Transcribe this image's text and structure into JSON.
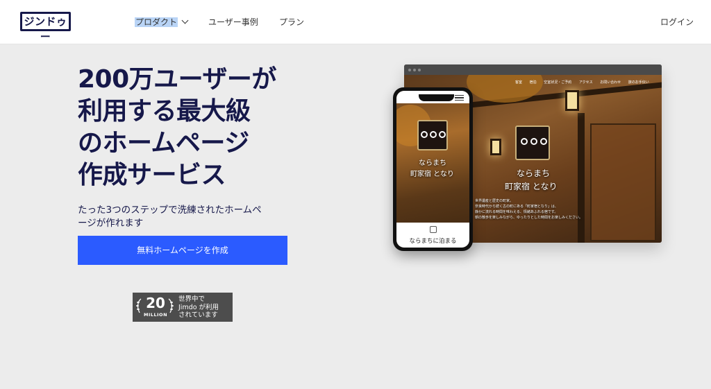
{
  "header": {
    "logo": "ジンドゥー",
    "nav": [
      {
        "label": "プロダクト"
      },
      {
        "label": "ユーザー事例"
      },
      {
        "label": "プラン"
      }
    ],
    "login_label": "ログイン"
  },
  "hero": {
    "title_lines": [
      "200万ユーザーが",
      "利用する最大級",
      "のホームページ",
      "作成サービス"
    ],
    "subtitle_lines": [
      "たった3つのステップで洗練されたホームペ",
      "ージが作れます"
    ],
    "cta_label": "無料ホームページを作成"
  },
  "badge": {
    "number": "20",
    "unit": "MILLION",
    "text_lines": [
      "世界中で",
      "Jimdo が利用",
      "されています"
    ]
  },
  "mockup": {
    "desktop_menu": [
      "客室",
      "宿泊",
      "空室状況・ご予約",
      "アクセス",
      "お問い合わせ",
      "旅のお手伝い"
    ],
    "site_title_1": "ならまち",
    "site_title_2": "町家宿 となり",
    "site_text_lines": [
      "世界遺産と歴史の町家。",
      "奈良時代から続く古の町にある「町家宿となり」は、",
      "静かに流れる時間を味わえる、情緒あふれる宿です。",
      "朝の散歩を楽しみながら、ゆったりとした時間をお楽しみください。"
    ],
    "phone_caption": "ならまちに泊まる"
  },
  "colors": {
    "brand_navy": "#16184a",
    "cta_blue": "#2b5bff",
    "page_bg": "#ececec",
    "nav_highlight": "#b9d4f6"
  }
}
